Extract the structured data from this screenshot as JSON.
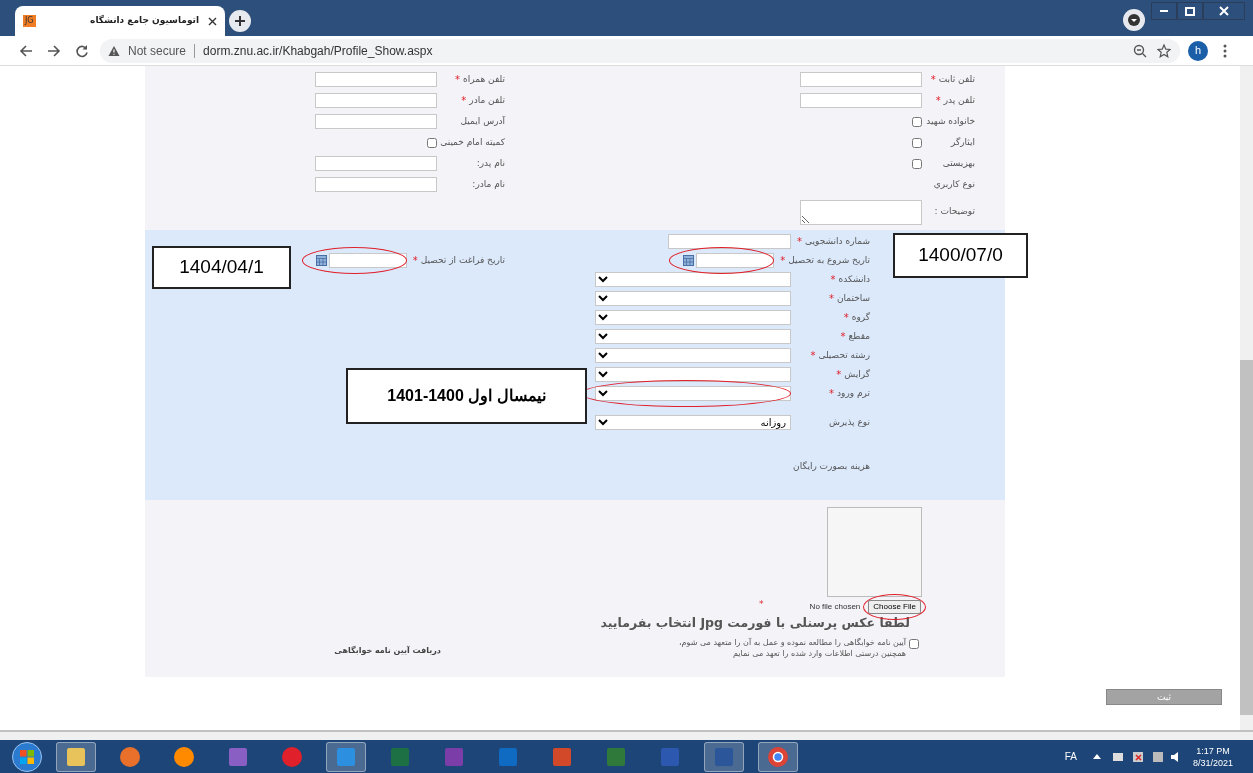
{
  "browser": {
    "favicon_text": "JG",
    "tab_title": "اتوماسیون جامع دانشگاه",
    "security": "Not secure",
    "url": "dorm.znu.ac.ir/Khabgah/Profile_Show.aspx",
    "profile_initial": "h"
  },
  "personal": {
    "right": [
      {
        "label": "تلفن ثابت",
        "kind": "input",
        "mark": "*"
      },
      {
        "label": "تلفن پدر",
        "kind": "input",
        "mark": "*"
      },
      {
        "label": "خانواده شهید",
        "kind": "checkbox",
        "checked": false
      },
      {
        "label": "ایثارگر",
        "kind": "checkbox",
        "checked": false
      },
      {
        "label": "بهزیستی",
        "kind": "checkbox",
        "checked": false
      },
      {
        "label": "نوع کاربري",
        "kind": "text"
      },
      {
        "label": "توضیحات :",
        "kind": "textarea"
      }
    ],
    "left": [
      {
        "label": "تلفن همراه",
        "kind": "input",
        "mark": "*"
      },
      {
        "label": "تلفن مادر",
        "kind": "input",
        "mark": "*"
      },
      {
        "label": "آدرس ایمیل",
        "kind": "input"
      },
      {
        "label": "کمیته امام خمینی",
        "kind": "checkbox",
        "checked": false
      },
      {
        "label": "نام پدر:",
        "kind": "input"
      },
      {
        "label": "نام مادر:",
        "kind": "input"
      }
    ]
  },
  "education": {
    "right": [
      {
        "label": "شماره دانشجویی",
        "kind": "input",
        "mark": "*"
      },
      {
        "label": "تاریخ  شروع به تحصیل",
        "kind": "date",
        "mark": "*",
        "highlighted": true
      },
      {
        "label": "دانشکده",
        "kind": "select",
        "mark": "*"
      },
      {
        "label": "ساختمان",
        "kind": "select",
        "mark": "*"
      },
      {
        "label": "گروه",
        "kind": "select",
        "mark": "*"
      },
      {
        "label": "مقطع",
        "kind": "select",
        "mark": "*"
      },
      {
        "label": "رشته تحصیلی",
        "kind": "select",
        "mark": "*"
      },
      {
        "label": "گرایش",
        "kind": "select",
        "mark": "*"
      },
      {
        "label": "ترم ورود",
        "kind": "select",
        "mark": "*",
        "highlighted": true
      },
      {
        "label": "نوع پذیرش",
        "kind": "select",
        "value": "روزانه"
      }
    ],
    "left": [
      {
        "label": "تاریخ فراغت از تحصیل",
        "kind": "date",
        "mark": "*",
        "highlighted": true
      }
    ],
    "note": "هزینه بصورت رایگان"
  },
  "photo": {
    "file_status": "No file chosen",
    "button": "Choose File",
    "highlighted": true,
    "mark": "*",
    "instruction": "لطفا عکس پرسنلی با  فورمت Jpg انتخاب بفرمایید"
  },
  "agreement": {
    "checked": false,
    "text": "آیین نامه خوابگاهی را مطالعه نموده و عمل به آن را متعهد می شوم،\nهمچنین درستی اطلاعات وارد شده را تعهد می نمایم"
  },
  "rules_link": "دریافت آیین نامه خوابگاهی",
  "submit": "ثبت",
  "annotations": [
    {
      "text": "1400/07/0"
    },
    {
      "text": "1404/04/1"
    },
    {
      "text": "نیمسال اول 1400-1401"
    }
  ],
  "taskbar": {
    "language": "FA",
    "time": "1:17 PM",
    "date": "8/31/2021"
  }
}
